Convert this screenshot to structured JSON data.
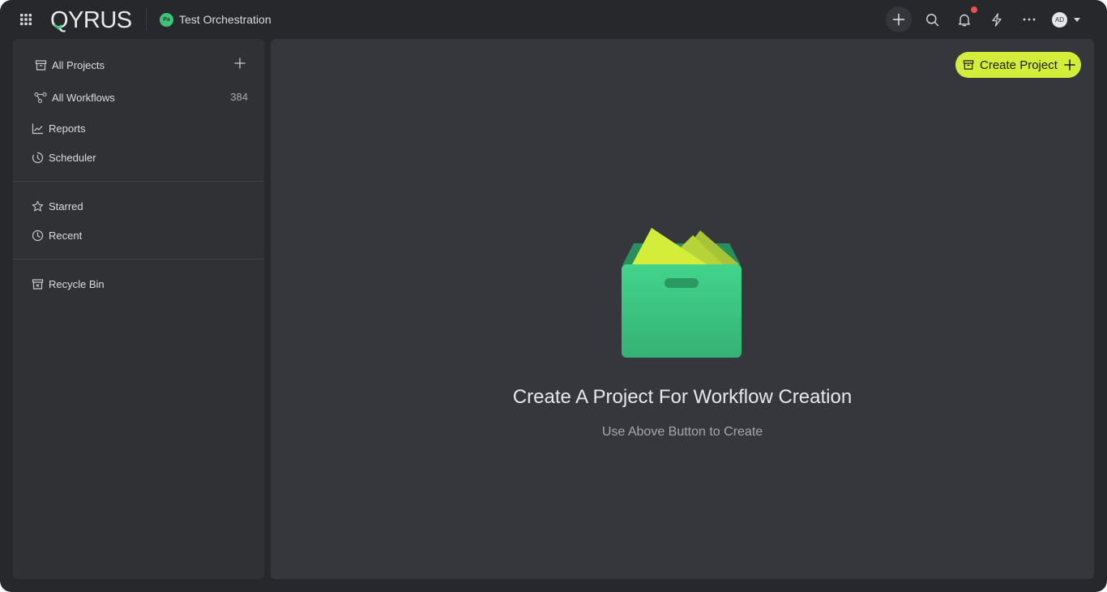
{
  "header": {
    "logo_text": "QYRUS",
    "workspace_initials": "Pa",
    "workspace_name": "Test Orchestration",
    "user_initials": "AD",
    "icons": [
      "apps-grid-icon",
      "plus-icon",
      "search-icon",
      "bell-icon",
      "bolt-icon",
      "more-icon",
      "chevron-down-icon"
    ]
  },
  "sidebar": {
    "items": [
      {
        "label": "All Projects",
        "icon": "archive-box-icon"
      },
      {
        "label": "All Workflows",
        "icon": "workflow-icon",
        "count": "384"
      },
      {
        "label": "Reports",
        "icon": "line-chart-icon"
      },
      {
        "label": "Scheduler",
        "icon": "timer-icon"
      },
      {
        "label": "Starred",
        "icon": "star-icon"
      },
      {
        "label": "Recent",
        "icon": "clock-icon"
      },
      {
        "label": "Recycle Bin",
        "icon": "recycle-bin-icon"
      }
    ]
  },
  "main": {
    "create_button_label": "Create Project",
    "empty_title": "Create A Project For Workflow Creation",
    "empty_subtitle": "Use Above Button to Create"
  },
  "colors": {
    "accent": "#d4ec3a",
    "app_bg": "#27282c",
    "panel_bg": "#36373c",
    "sidebar_bg": "#303135",
    "notification": "#e8534f",
    "box_green": "#3ec47a"
  }
}
